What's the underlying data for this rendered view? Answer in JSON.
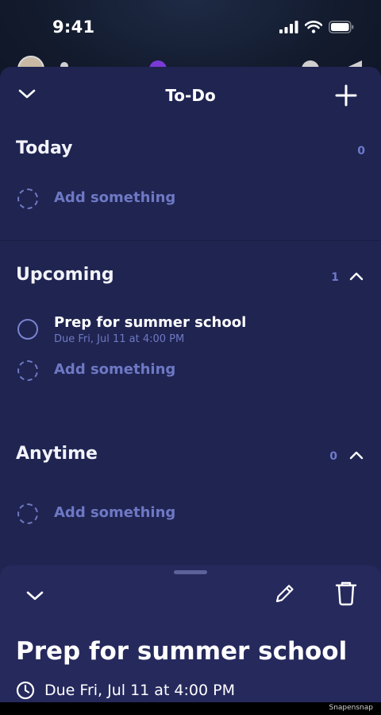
{
  "status_bar": {
    "time": "9:41"
  },
  "header": {
    "title": "To-Do"
  },
  "sections": [
    {
      "title": "Today",
      "count": "0",
      "add_label": "Add something"
    },
    {
      "title": "Upcoming",
      "count": "1",
      "add_label": "Add something",
      "tasks": [
        {
          "title": "Prep for summer school",
          "due": "Due Fri, Jul 11 at 4:00 PM"
        }
      ]
    },
    {
      "title": "Anytime",
      "count": "0",
      "add_label": "Add something"
    }
  ],
  "detail": {
    "title": "Prep for summer school",
    "due": "Due Fri, Jul 11 at 4:00 PM"
  },
  "footer": {
    "watermark": "Snapensnap"
  },
  "colors": {
    "sheet_bg": "#1f2451",
    "detail_bg": "#25295c",
    "accent_muted": "#6f79c2",
    "text": "#ffffff"
  },
  "icons": [
    "chevron-down-icon",
    "plus-icon",
    "chevron-up-icon",
    "pencil-icon",
    "trash-icon",
    "clock-icon",
    "signal-icon",
    "wifi-icon",
    "battery-icon"
  ]
}
